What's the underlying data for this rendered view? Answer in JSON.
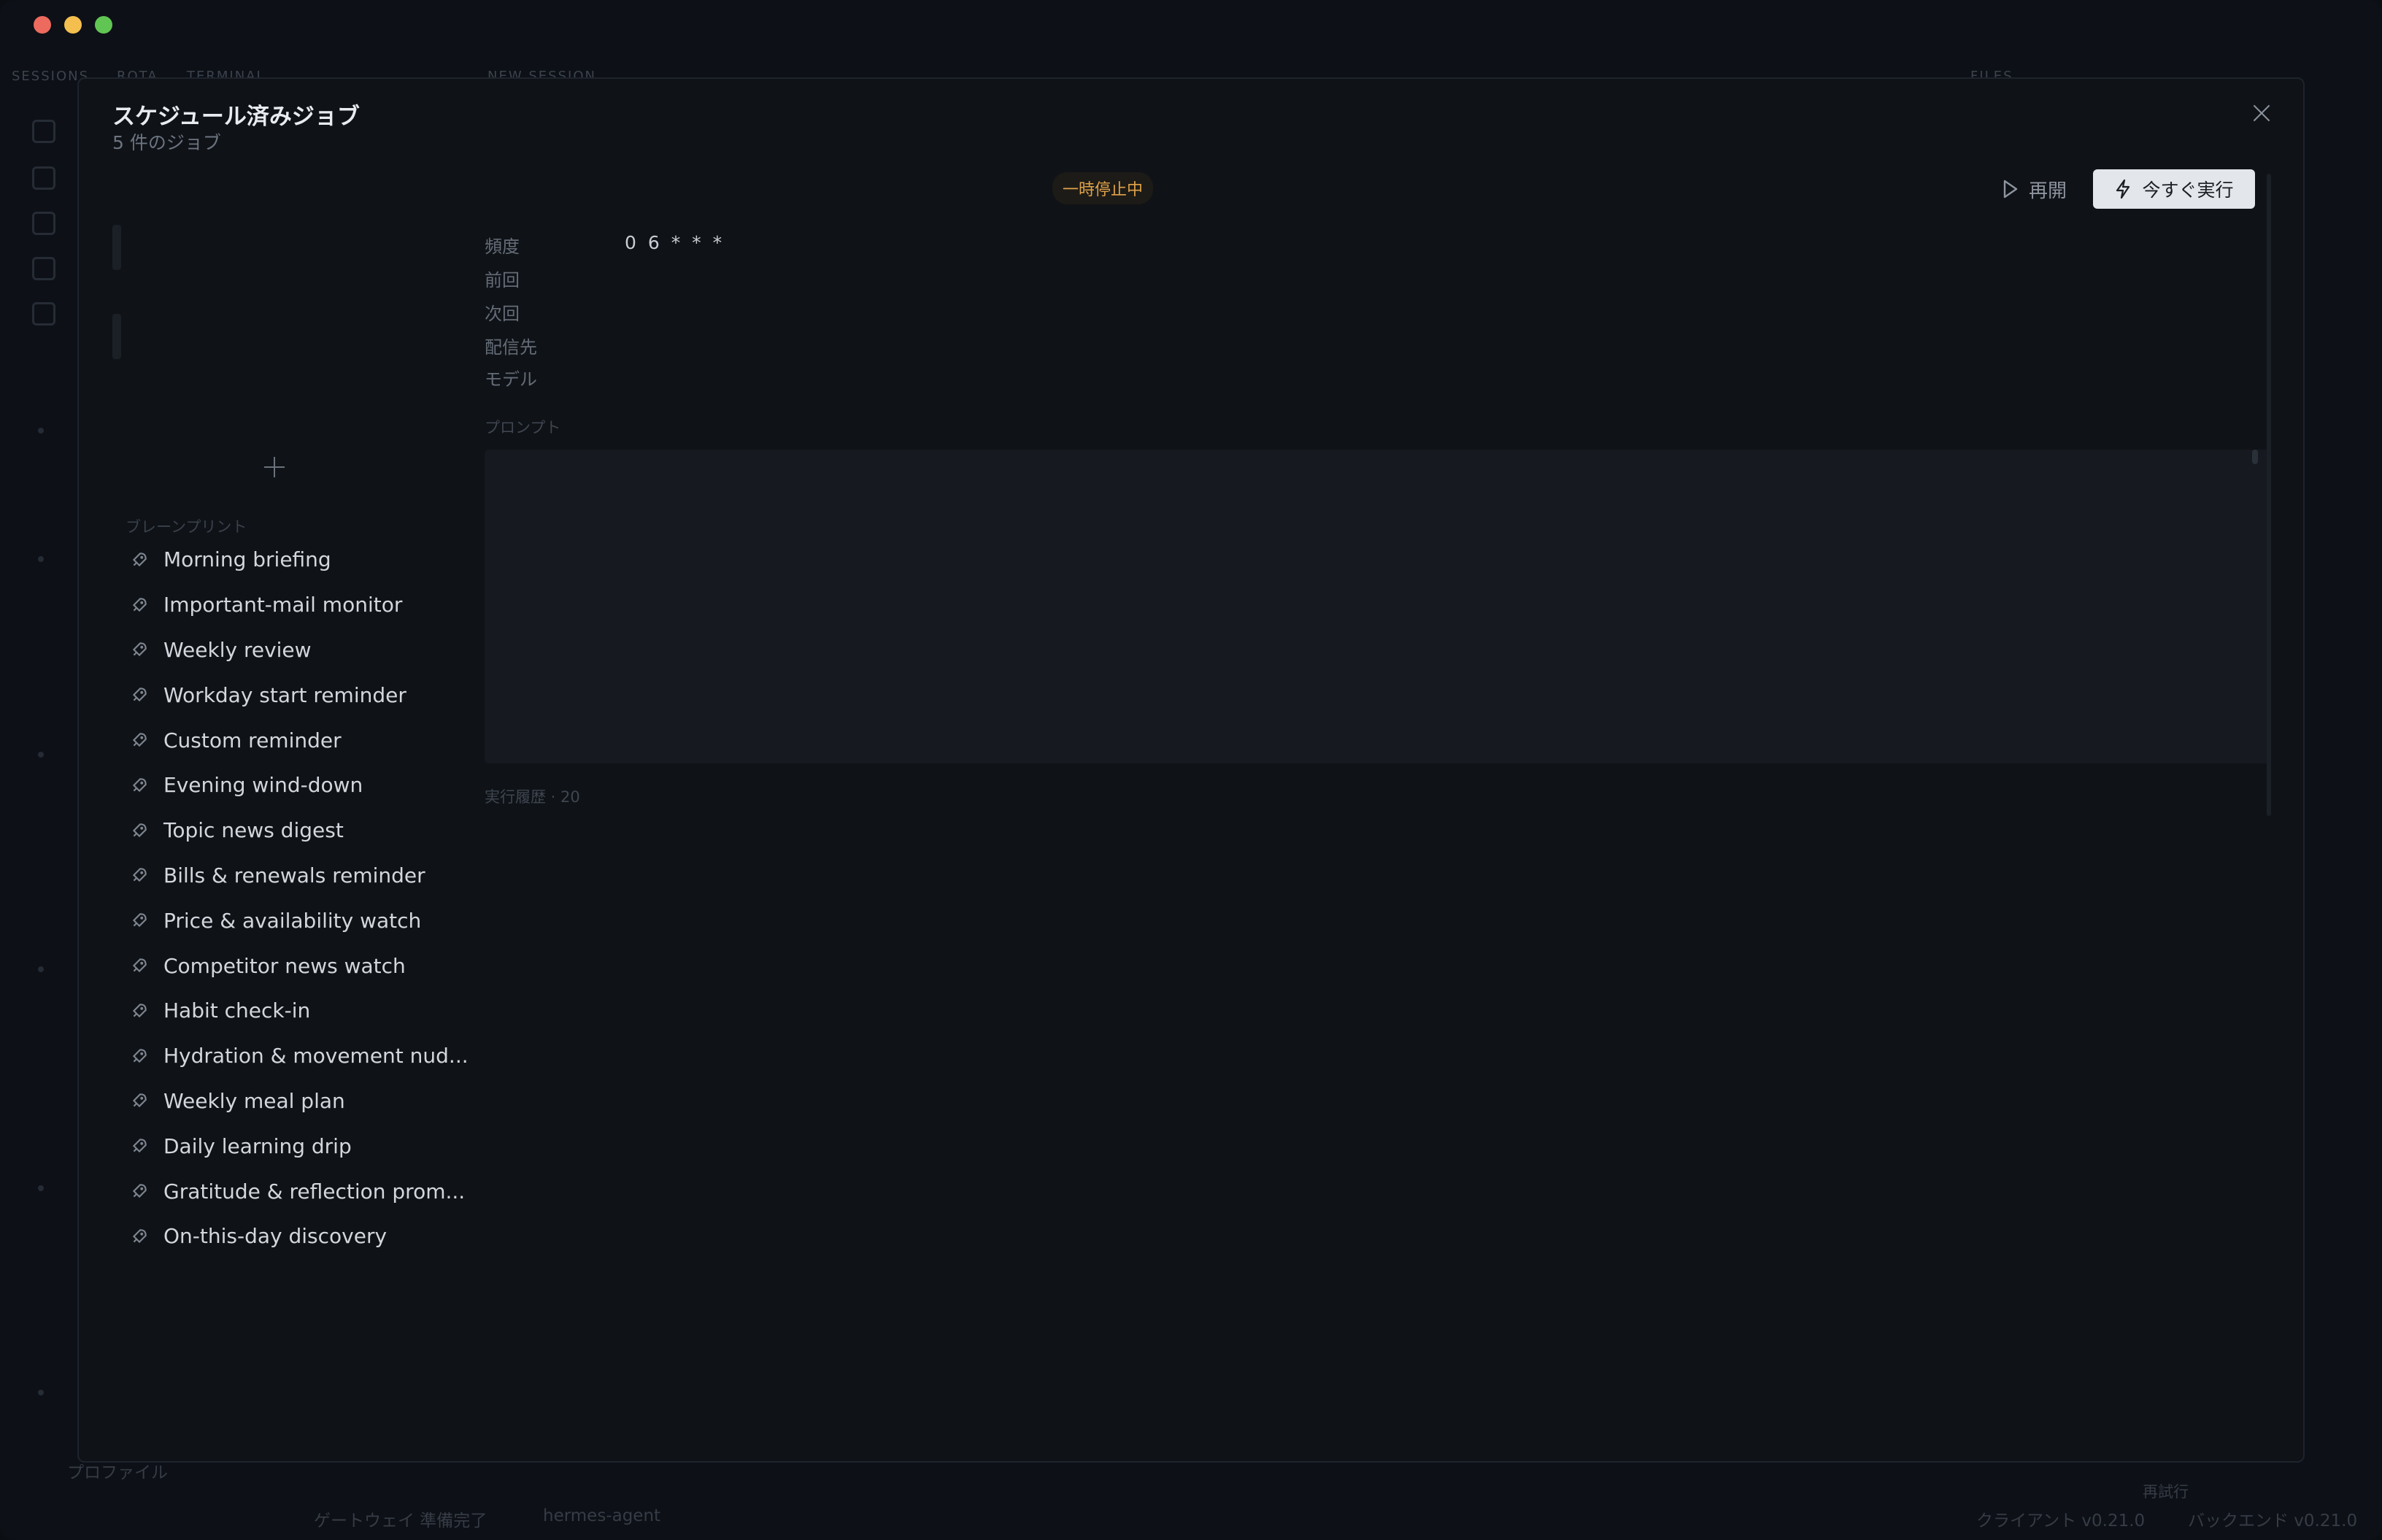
{
  "background_app": {
    "tabs": [
      "SESSIONS",
      "ROTA",
      "TERMINAL",
      "NEW SESSION",
      "FILES"
    ],
    "footer": {
      "profile": "プロファイル",
      "gateway": "ゲートウェイ 準備完了",
      "workspace": "hermes-agent",
      "retry": "再試行",
      "client_version": "クライアント v0.21.0",
      "backend_version": "バックエンド v0.21.0"
    }
  },
  "modal": {
    "title": "スケジュール済みジョブ",
    "subtitle": "5 件のジョブ",
    "blueprints_label": "ブレーンプリント",
    "blueprints": [
      "Morning briefing",
      "Important-mail monitor",
      "Weekly review",
      "Workday start reminder",
      "Custom reminder",
      "Evening wind-down",
      "Topic news digest",
      "Bills & renewals reminder",
      "Price & availability watch",
      "Competitor news watch",
      "Habit check-in",
      "Hydration & movement nud...",
      "Weekly meal plan",
      "Daily learning drip",
      "Gratitude & reflection prom...",
      "On-this-day discovery"
    ],
    "detail": {
      "status": "一時停止中",
      "resume_label": "再開",
      "run_now_label": "今すぐ実行",
      "fields": [
        {
          "label": "頻度",
          "value": "0 6 * * *"
        },
        {
          "label": "前回",
          "value": ""
        },
        {
          "label": "次回",
          "value": ""
        },
        {
          "label": "配信先",
          "value": ""
        },
        {
          "label": "モデル",
          "value": ""
        }
      ],
      "prompt_label": "プロンプト",
      "history_label": "実行履歴 · 20"
    }
  }
}
